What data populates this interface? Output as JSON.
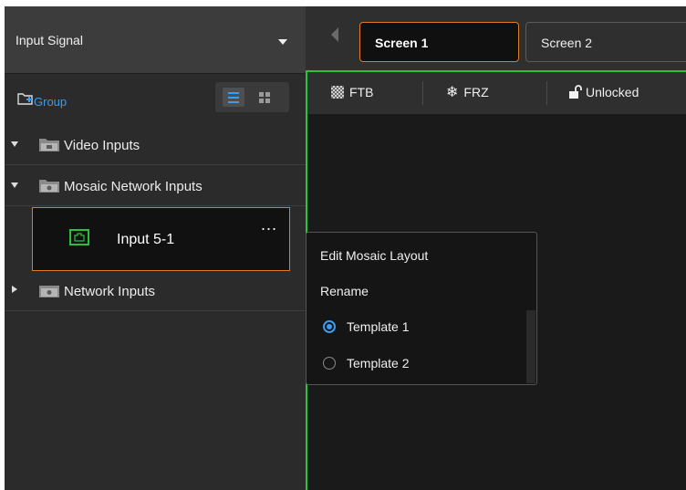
{
  "source_panel": {
    "title": "Input Signal",
    "add_group_label": "Group",
    "groups": [
      {
        "label": "Video Inputs",
        "expanded": true,
        "icon": "folder-video-icon"
      },
      {
        "label": "Mosaic Network Inputs",
        "expanded": true,
        "icon": "folder-network-icon"
      },
      {
        "label": "Network Inputs",
        "expanded": false,
        "icon": "folder-network-icon"
      }
    ],
    "selected_input": {
      "label": "Input 5-1",
      "more": "...",
      "icon": "input-source-icon"
    }
  },
  "tabs": [
    {
      "label": "Screen 1",
      "active": true
    },
    {
      "label": "Screen 2",
      "active": false
    }
  ],
  "screen_toolbar": {
    "ftb_label": "FTB",
    "frz_label": "FRZ",
    "lock_label": "Unlocked"
  },
  "context_menu": {
    "items": [
      "Edit Mosaic Layout",
      "Rename"
    ],
    "templates": [
      {
        "label": "Template 1",
        "selected": true
      },
      {
        "label": "Template 2",
        "selected": false
      }
    ]
  },
  "colors": {
    "accent_orange": "#e07b22",
    "accent_blue": "#3a9cf0",
    "screen_border_green": "#27c53c",
    "panel_bg": "#2b2b2b"
  }
}
